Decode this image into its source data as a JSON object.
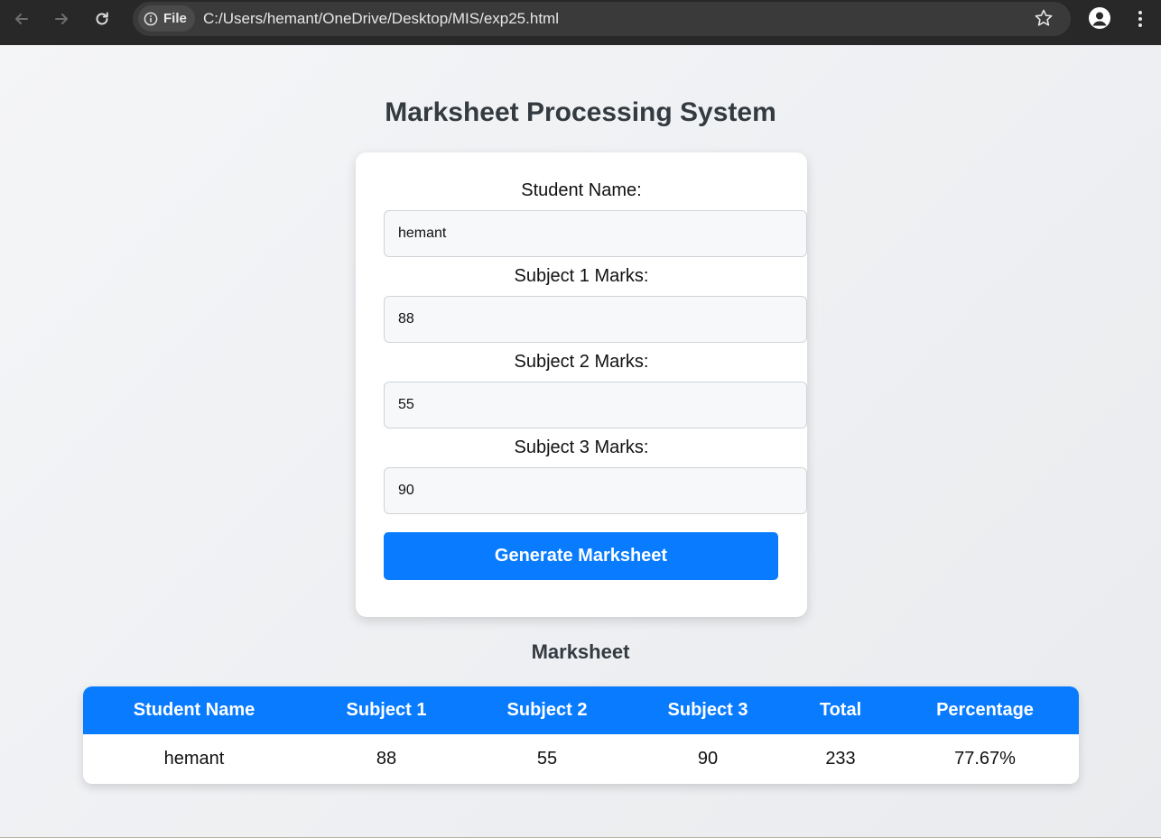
{
  "browser": {
    "file_chip": "File",
    "url": "C:/Users/hemant/OneDrive/Desktop/MIS/exp25.html"
  },
  "page": {
    "title": "Marksheet Processing System"
  },
  "form": {
    "name_label": "Student Name:",
    "name_value": "hemant",
    "sub1_label": "Subject 1 Marks:",
    "sub1_value": "88",
    "sub2_label": "Subject 2 Marks:",
    "sub2_value": "55",
    "sub3_label": "Subject 3 Marks:",
    "sub3_value": "90",
    "button_label": "Generate Marksheet"
  },
  "marksheet": {
    "title": "Marksheet",
    "headers": [
      "Student Name",
      "Subject 1",
      "Subject 2",
      "Subject 3",
      "Total",
      "Percentage"
    ],
    "rows": [
      [
        "hemant",
        "88",
        "55",
        "90",
        "233",
        "77.67%"
      ]
    ]
  },
  "colors": {
    "accent": "#087bff",
    "chrome": "#282828"
  }
}
